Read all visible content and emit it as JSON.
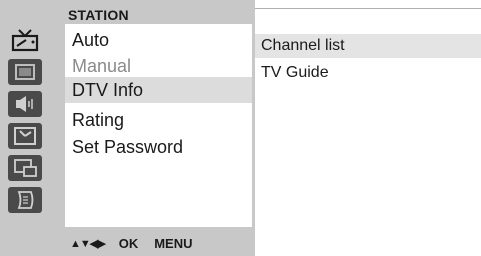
{
  "menu": {
    "title": "STATION",
    "items": [
      {
        "label": "Auto",
        "state": "normal"
      },
      {
        "label": "Manual",
        "state": "disabled"
      },
      {
        "label": "DTV Info",
        "state": "highlighted"
      },
      {
        "label": "Rating",
        "state": "normal"
      },
      {
        "label": "Set Password",
        "state": "normal"
      }
    ]
  },
  "sidebar_icons": [
    {
      "name": "tv-station-icon",
      "active": true
    },
    {
      "name": "picture-icon",
      "active": false
    },
    {
      "name": "speaker-icon",
      "active": false
    },
    {
      "name": "clock-icon",
      "active": false
    },
    {
      "name": "pip-icon",
      "active": false
    },
    {
      "name": "setup-icon",
      "active": false
    }
  ],
  "footer": {
    "nav_arrows": "▲▼◀▶",
    "ok": "OK",
    "menu": "MENU"
  },
  "submenu": {
    "items": [
      {
        "label": "Channel list",
        "state": "highlighted"
      },
      {
        "label": "TV Guide",
        "state": "normal"
      }
    ]
  },
  "colors": {
    "panel": "#c8c8c8",
    "icon_tile": "#4a4a4a",
    "highlight": "#dcdcdc"
  }
}
